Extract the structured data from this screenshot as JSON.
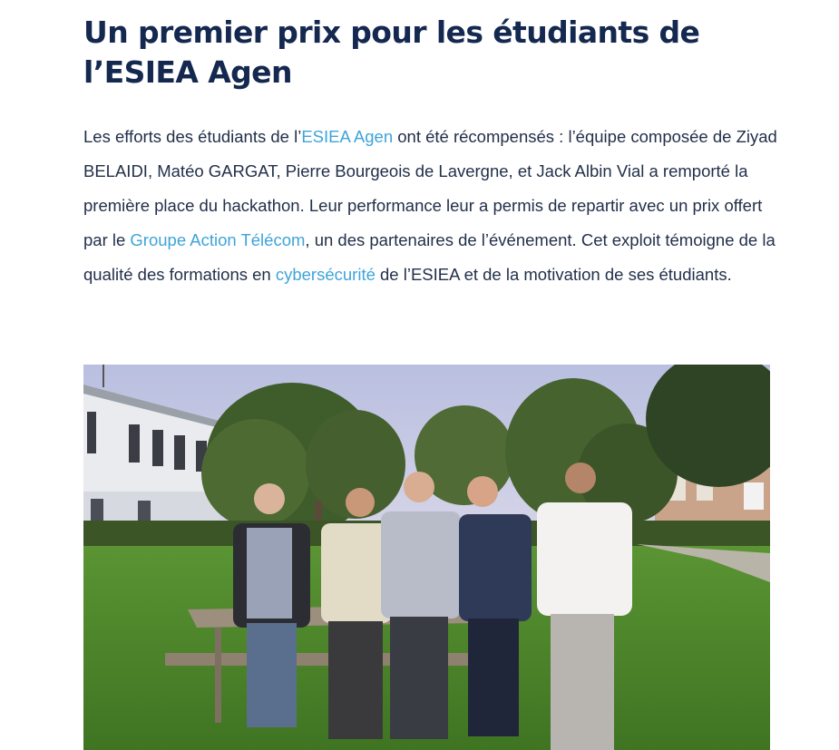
{
  "article": {
    "title": "Un premier prix pour les étudiants de l’ESIEA Agen",
    "paragraph": {
      "t1": "Les efforts des étudiants de l’",
      "link1": "ESIEA Agen",
      "t2": " ont été récompensés : l’équipe composée de Ziyad BELAIDI, Matéo GARGAT, Pierre Bourgeois de Lavergne, et Jack Albin Vial a remporté la première place du hackathon. Leur performance leur a permis de repartir avec un prix offert par le ",
      "link2": "Groupe Action Télécom",
      "t3": ", un des partenaires de l’événement. Cet exploit témoigne de la qualité des formations en ",
      "link3": "cybersécurité",
      "t4": " de l’ESIEA et de la motivation de ses étudiants."
    },
    "photo": {
      "subject": "team-photo",
      "colors": {
        "sky": "#c9cde6",
        "grass": "#4f8a2c",
        "trees": "#3d5a2a"
      }
    }
  },
  "colors": {
    "title": "#142850",
    "text": "#23304a",
    "link": "#3fa4d9"
  }
}
